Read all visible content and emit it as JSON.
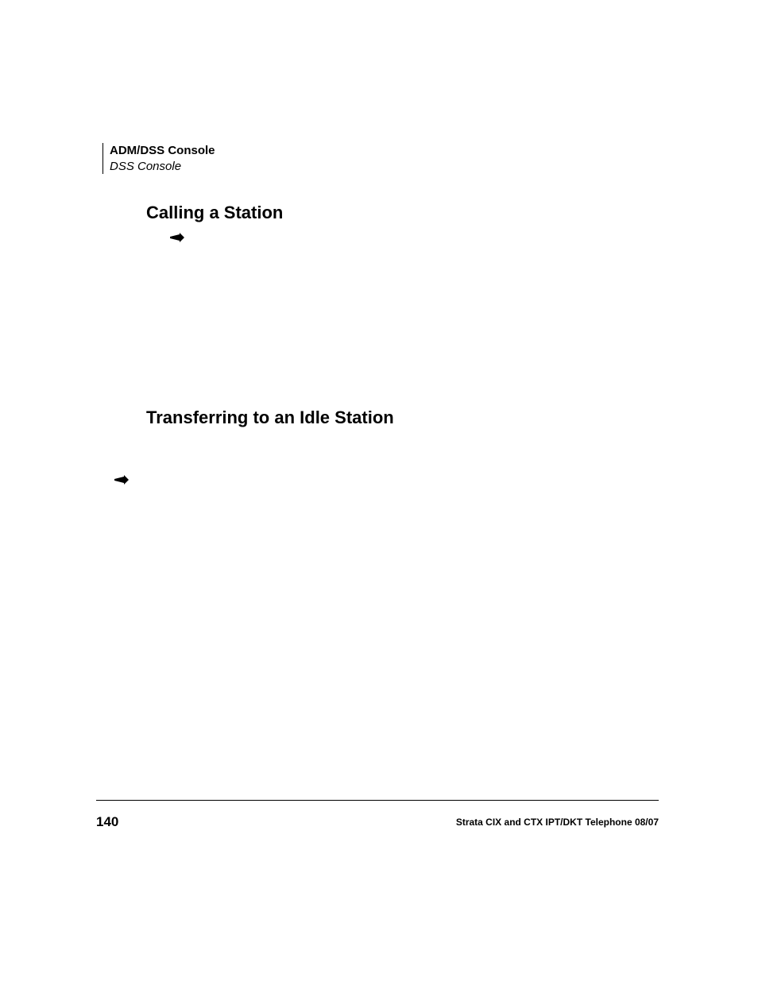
{
  "header": {
    "chapter": "ADM/DSS Console",
    "section": "DSS Console"
  },
  "sections": {
    "heading1": "Calling a Station",
    "heading2": "Transferring to an Idle Station"
  },
  "footer": {
    "page_number": "140",
    "doc_title": "Strata CIX and CTX IPT/DKT Telephone     08/07"
  }
}
